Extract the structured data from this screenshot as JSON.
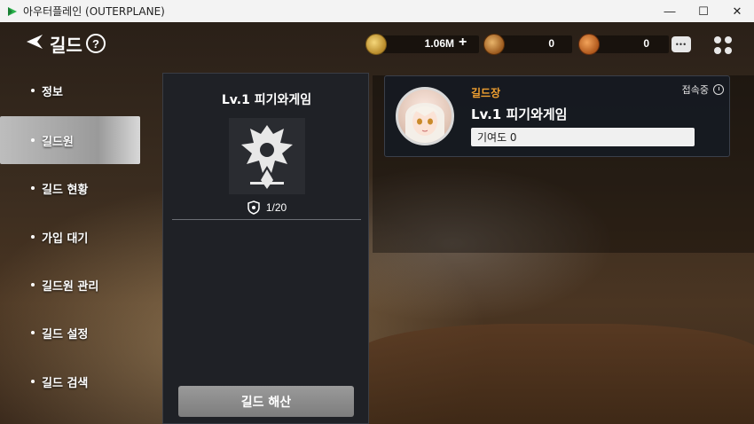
{
  "window": {
    "title": "아우터플레인 (OUTERPLANE)",
    "controls": {
      "minimize": "—",
      "maximize": "☐",
      "close": "✕"
    }
  },
  "header": {
    "title": "길드",
    "help": "?",
    "currencies": [
      {
        "name": "gold-coin",
        "amount": "1.06M",
        "plus": "+"
      },
      {
        "name": "guild-badge",
        "amount": "0"
      },
      {
        "name": "guild-medal",
        "amount": "0"
      }
    ]
  },
  "sidebar": {
    "items": [
      {
        "label": "정보",
        "active": false
      },
      {
        "label": "길드원",
        "active": true
      },
      {
        "label": "길드 현황",
        "active": false
      },
      {
        "label": "가입 대기",
        "active": false
      },
      {
        "label": "길드원 관리",
        "active": false
      },
      {
        "label": "길드 설정",
        "active": false
      },
      {
        "label": "길드 검색",
        "active": false
      }
    ]
  },
  "guild": {
    "name": "Lv.1 피기와게임",
    "members": "1/20",
    "disband_label": "길드 해산"
  },
  "member": {
    "role": "길드장",
    "status": "접속중",
    "name": "Lv.1 피기와게임",
    "contribution": "기여도 0"
  },
  "colors": {
    "role": "#f0a030",
    "panel": "#1f2126",
    "active_tab": "#9a9a9a"
  }
}
